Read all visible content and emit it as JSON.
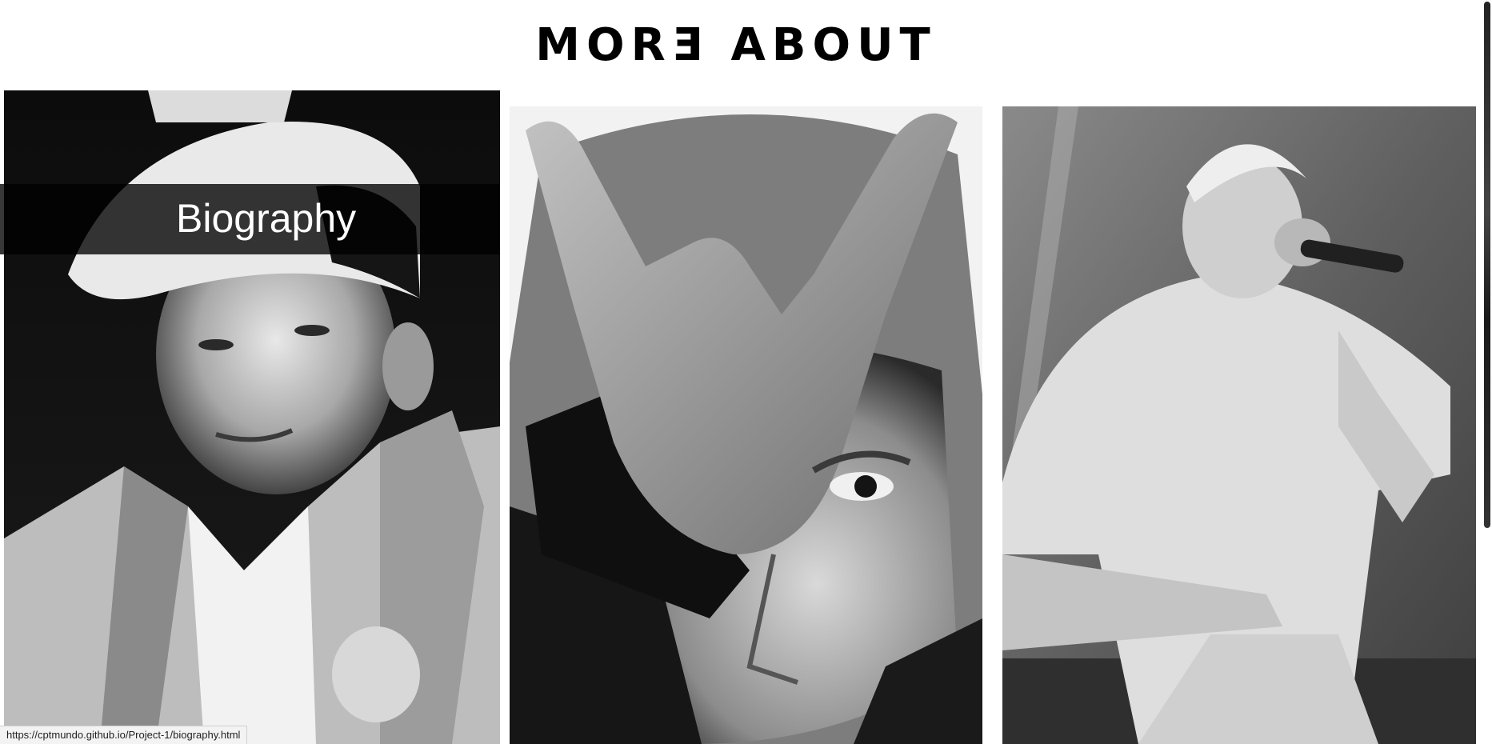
{
  "section": {
    "title": "MORƎ ABOUT"
  },
  "cards": [
    {
      "label": "Biography",
      "photo": "portrait-with-cap-photo"
    },
    {
      "label": "",
      "photo": "hand-gesture-portrait-photo"
    },
    {
      "label": "",
      "photo": "performing-with-microphone-photo"
    }
  ],
  "status_bar": {
    "url": "https://cptmundo.github.io/Project-1/biography.html"
  }
}
